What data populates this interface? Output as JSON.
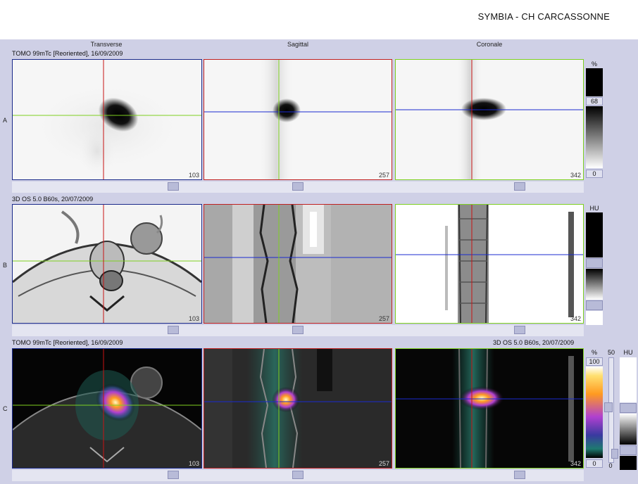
{
  "header": {
    "title": "SYMBIA - CH CARCASSONNE"
  },
  "columns": [
    "Transverse",
    "Sagittal",
    "Coronale"
  ],
  "rows": [
    {
      "letter": "A",
      "series_left": "TOMO 99mTc [Reoriented], 16/09/2009",
      "series_right": "",
      "slices": [
        "103",
        "257",
        "342"
      ],
      "bar": {
        "unit": "%",
        "top_value": "68",
        "bottom_value": "0"
      }
    },
    {
      "letter": "B",
      "series_left": "3D  OS  5.0  B60s, 20/07/2009",
      "series_right": "",
      "slices": [
        "103",
        "257",
        "342"
      ],
      "bar": {
        "unit": "HU",
        "top_value": "",
        "bottom_value": ""
      }
    },
    {
      "letter": "C",
      "series_left": "TOMO 99mTc [Reoriented], 16/09/2009",
      "series_right": "3D  OS  5.0  B60s, 20/07/2009",
      "slices": [
        "103",
        "257",
        "342"
      ],
      "bar": {
        "unit": "%",
        "top_value": "100",
        "bottom_value": "0",
        "blend_value": "50",
        "blend_min": "0",
        "unit2": "HU"
      }
    }
  ],
  "colors": {
    "workspace": "#cfd0e6",
    "transverse_frame": "#1a2a8a",
    "sagittal_frame": "#c02020",
    "coronal_frame": "#7ed020",
    "crosshair_red": "#c81414",
    "crosshair_green": "#7ed020",
    "crosshair_blue": "#1a2ad0"
  },
  "icons": {
    "viewport_scroll": "scroll-thumb"
  }
}
